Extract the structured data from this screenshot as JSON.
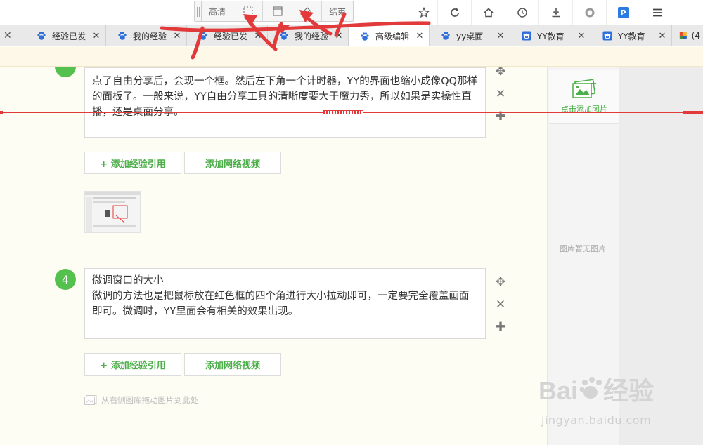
{
  "recorder": {
    "quality_label": "高清",
    "end_label": "结束",
    "icons": [
      "region-select-icon",
      "window-icon",
      "home-capture-icon"
    ]
  },
  "browser_nav": {
    "icons": [
      "star-icon",
      "refresh-icon",
      "home-icon",
      "history-icon",
      "download-icon",
      "record-icon",
      "p-app-icon",
      "menu-icon"
    ],
    "p_badge": "P"
  },
  "tabs": [
    {
      "label": "经验已发",
      "icon": "baidu-paw-icon",
      "active": false
    },
    {
      "label": "我的经验",
      "icon": "baidu-paw-icon",
      "active": false
    },
    {
      "label": "经验已发",
      "icon": "baidu-paw-icon",
      "active": false
    },
    {
      "label": "我的经验",
      "icon": "baidu-paw-icon",
      "active": false
    },
    {
      "label": "高级编辑",
      "icon": "baidu-paw-icon",
      "active": true
    },
    {
      "label": "yy桌面",
      "icon": "baidu-paw-icon",
      "active": false
    },
    {
      "label": "YY教育",
      "icon": "edu-cap-icon",
      "active": false
    },
    {
      "label": "YY教育",
      "icon": "edu-cap-icon",
      "active": false
    }
  ],
  "tab_last_label": "(4",
  "step3": {
    "text": "点了自由分享后，会现一个框。然后左下角一个计时器，YY的界面也缩小成像QQ那样的面板了。一般来说，YY自由分享工具的清晰度要大于魔力秀，所以如果是实操性直播，还是桌面分享。"
  },
  "step4": {
    "number": "4",
    "title": "微调窗口的大小",
    "text": "微调的方法也是把鼠标放在红色框的四个角进行大小拉动即可，一定要完全覆盖画面即可。微调时，YY里面会有相关的效果出现。"
  },
  "buttons": {
    "add_reference": "+ 添加经验引用",
    "add_video": "添加网络视频"
  },
  "drag_hint": "从右侧图库拖动图片到此处",
  "gallery": {
    "add_label": "点击添加图片",
    "empty_label": "图库暂无图片"
  },
  "watermark": {
    "brand": "Bai经验",
    "url": "jingyan.baidu.com"
  },
  "colors": {
    "green": "#54c04e",
    "annotation_red": "#e23a3a",
    "baidu_blue": "#2f6fdc"
  }
}
